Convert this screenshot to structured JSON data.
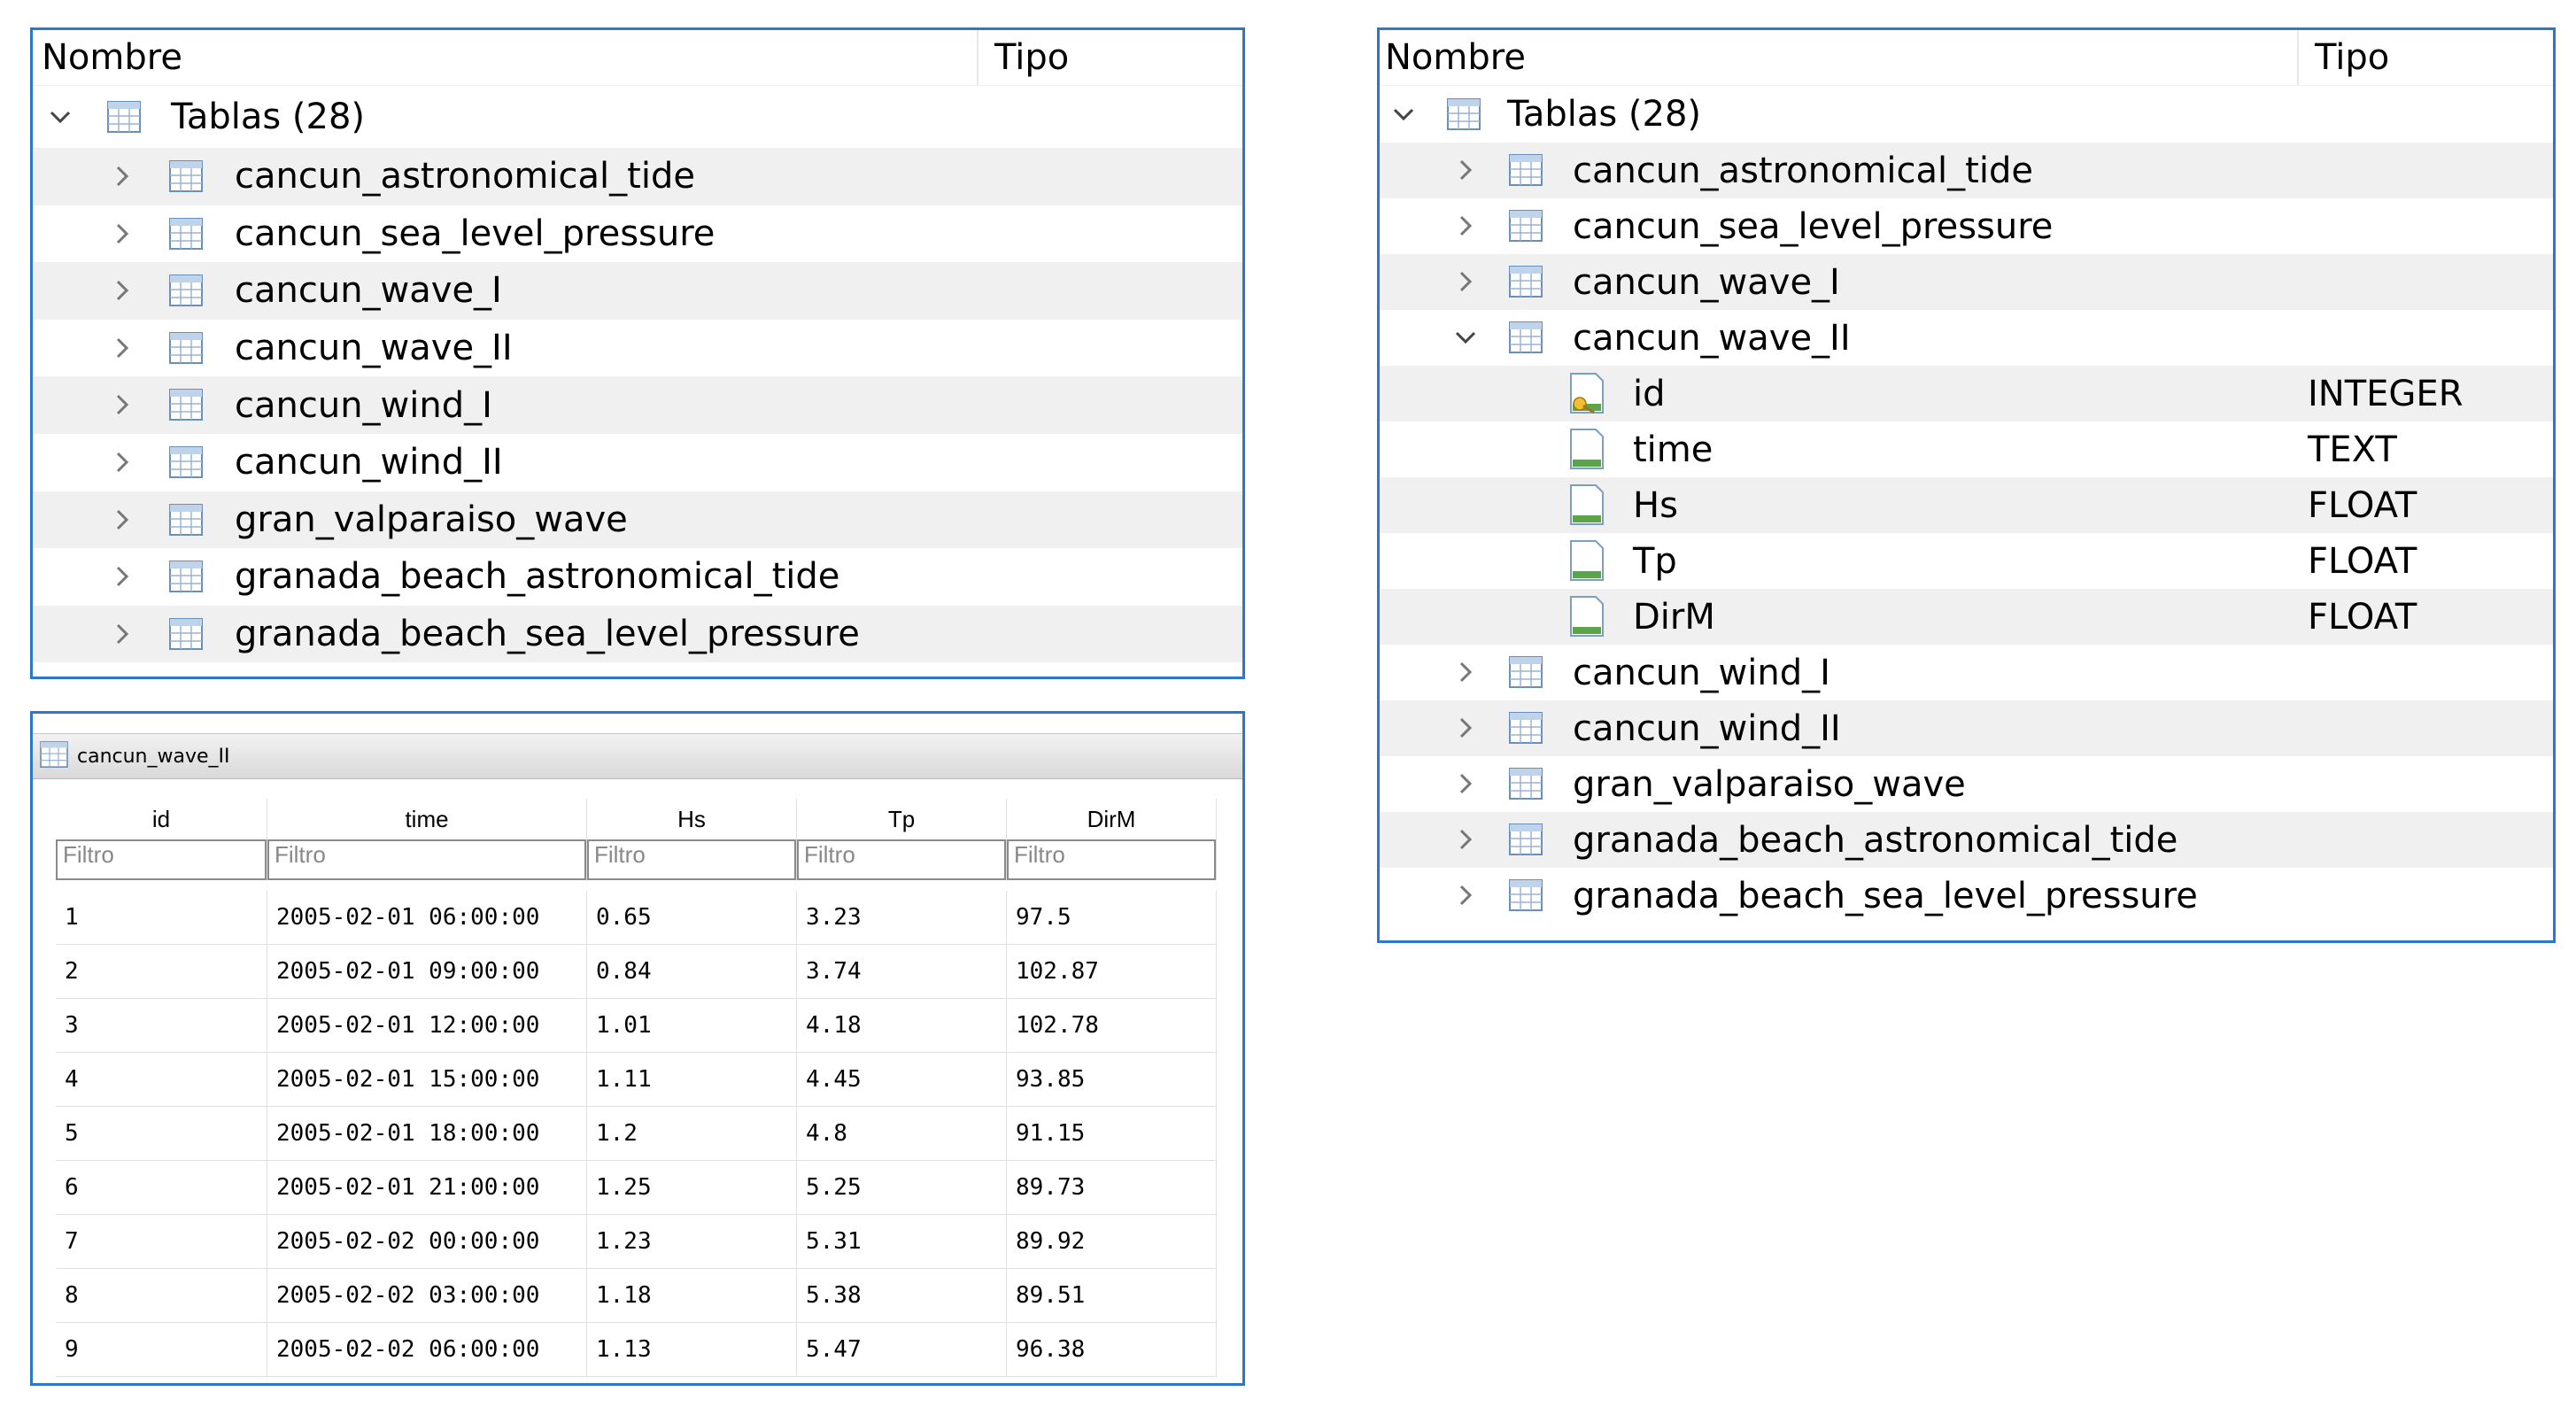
{
  "tree_left": {
    "header": {
      "name_col": "Nombre",
      "type_col": "Tipo"
    },
    "root": {
      "label": "Tablas (28)"
    },
    "tables": [
      "cancun_astronomical_tide",
      "cancun_sea_level_pressure",
      "cancun_wave_I",
      "cancun_wave_II",
      "cancun_wind_I",
      "cancun_wind_II",
      "gran_valparaiso_wave",
      "granada_beach_astronomical_tide",
      "granada_beach_sea_level_pressure"
    ]
  },
  "tree_right": {
    "header": {
      "name_col": "Nombre",
      "type_col": "Tipo"
    },
    "root": {
      "label": "Tablas (28)"
    },
    "tables_before": [
      "cancun_astronomical_tide",
      "cancun_sea_level_pressure",
      "cancun_wave_I"
    ],
    "expanded_table": "cancun_wave_II",
    "fields": [
      {
        "name": "id",
        "type": "INTEGER",
        "key": true
      },
      {
        "name": "time",
        "type": "TEXT",
        "key": false
      },
      {
        "name": "Hs",
        "type": "FLOAT",
        "key": false
      },
      {
        "name": "Tp",
        "type": "FLOAT",
        "key": false
      },
      {
        "name": "DirM",
        "type": "FLOAT",
        "key": false
      }
    ],
    "tables_after": [
      "cancun_wind_I",
      "cancun_wind_II",
      "gran_valparaiso_wave",
      "granada_beach_astronomical_tide",
      "granada_beach_sea_level_pressure"
    ]
  },
  "data_grid": {
    "title": "cancun_wave_II",
    "columns": [
      "id",
      "time",
      "Hs",
      "Tp",
      "DirM"
    ],
    "filter_placeholder": "Filtro",
    "rows": [
      [
        "1",
        "2005-02-01 06:00:00",
        "0.65",
        "3.23",
        "97.5"
      ],
      [
        "2",
        "2005-02-01 09:00:00",
        "0.84",
        "3.74",
        "102.87"
      ],
      [
        "3",
        "2005-02-01 12:00:00",
        "1.01",
        "4.18",
        "102.78"
      ],
      [
        "4",
        "2005-02-01 15:00:00",
        "1.11",
        "4.45",
        "93.85"
      ],
      [
        "5",
        "2005-02-01 18:00:00",
        "1.2",
        "4.8",
        "91.15"
      ],
      [
        "6",
        "2005-02-01 21:00:00",
        "1.25",
        "5.25",
        "89.73"
      ],
      [
        "7",
        "2005-02-02 00:00:00",
        "1.23",
        "5.31",
        "89.92"
      ],
      [
        "8",
        "2005-02-02 03:00:00",
        "1.18",
        "5.38",
        "89.51"
      ],
      [
        "9",
        "2005-02-02 06:00:00",
        "1.13",
        "5.47",
        "96.38"
      ]
    ]
  },
  "colors": {
    "panel_border": "#2b78c8",
    "alt_row": "#f0f0f0"
  },
  "icons": {
    "table": "table-icon",
    "field": "field-icon",
    "key_field": "key-field-icon",
    "expand": "chevron-right-icon",
    "collapse": "chevron-down-icon"
  }
}
